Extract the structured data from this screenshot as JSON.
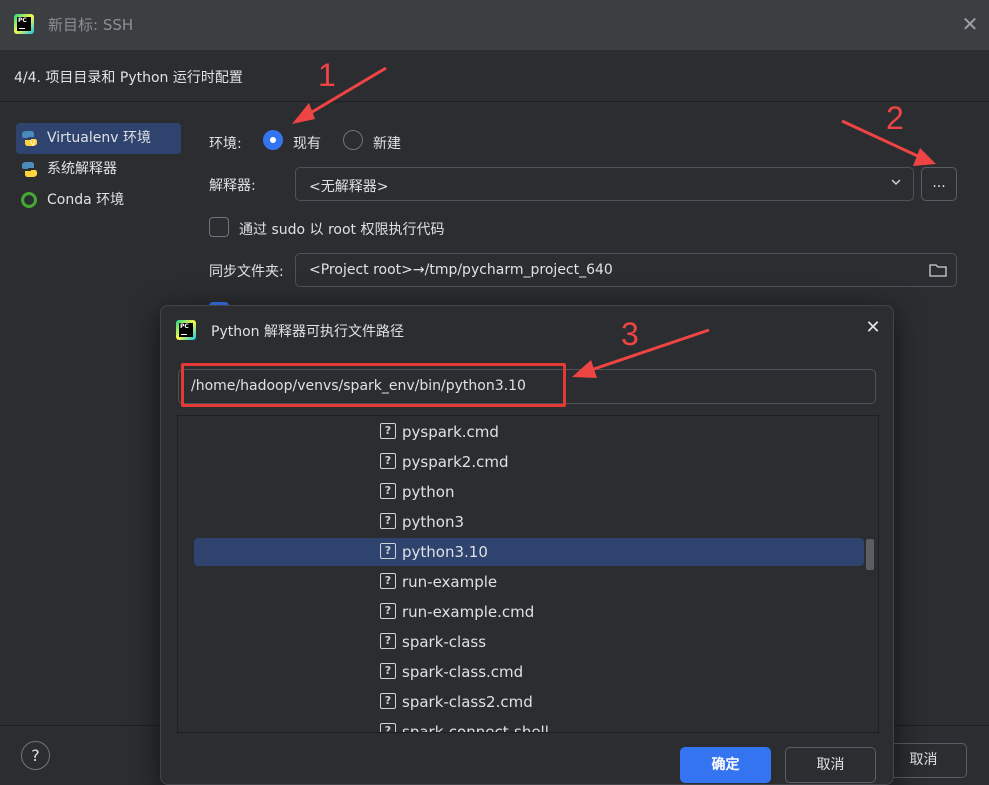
{
  "window": {
    "title": "新目标: SSH",
    "step": "4/4. 项目目录和 Python 运行时配置"
  },
  "env_list": [
    {
      "label": "Virtualenv 环境",
      "icon": "virtualenv-icon"
    },
    {
      "label": "系统解释器",
      "icon": "python-icon"
    },
    {
      "label": "Conda 环境",
      "icon": "conda-icon"
    }
  ],
  "form": {
    "env_label": "环境:",
    "radio_existing": "现有",
    "radio_new": "新建",
    "interpreter_label": "解释器:",
    "interpreter_value": "<无解释器>",
    "browse_label": "...",
    "sudo_label": "通过 sudo 以 root 权限执行代码",
    "sync_label": "同步文件夹:",
    "sync_value": "<Project root>→/tmp/pycharm_project_640"
  },
  "footer": {
    "help_label": "?",
    "cancel_label": "取消"
  },
  "dialog": {
    "title": "Python 解释器可执行文件路径",
    "path_value": "/home/hadoop/venvs/spark_env/bin/python3.10",
    "files": [
      "pyspark.cmd",
      "pyspark2.cmd",
      "python",
      "python3",
      "python3.10",
      "run-example",
      "run-example.cmd",
      "spark-class",
      "spark-class.cmd",
      "spark-class2.cmd",
      "spark-connect-shell"
    ],
    "selected_file": "python3.10",
    "ok_label": "确定",
    "cancel_label": "取消"
  },
  "annotations": [
    "1",
    "2",
    "3"
  ],
  "colors": {
    "accent": "#3574f0",
    "selection": "#2e436e",
    "annotation": "#ef4444"
  }
}
